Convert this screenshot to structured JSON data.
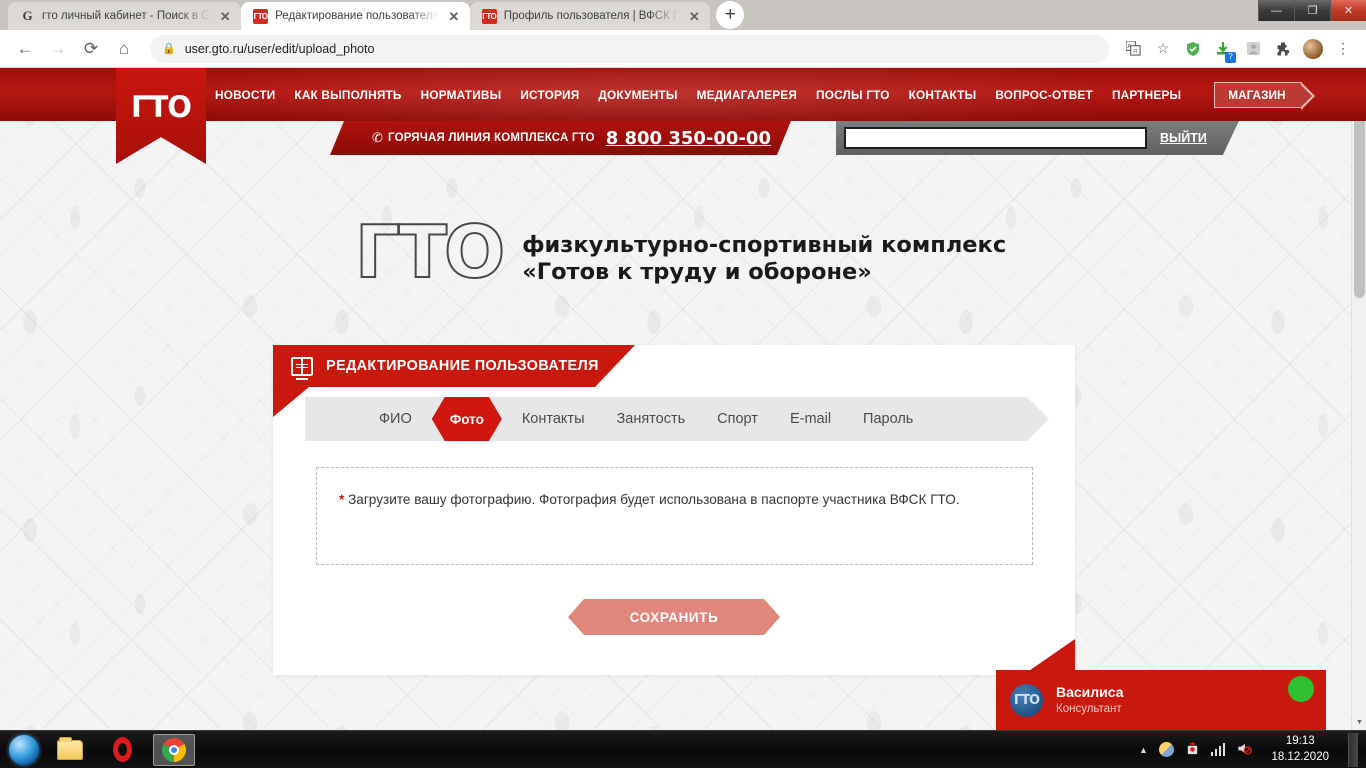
{
  "browser": {
    "tabs": [
      {
        "title": "гто личный кабинет - Поиск в G",
        "favicon": "google-icon",
        "active": false,
        "close_label": "✕"
      },
      {
        "title": "Редактирование пользователя",
        "favicon": "gto-favicon",
        "active": true,
        "close_label": "✕"
      },
      {
        "title": "Профиль пользователя | ВФСК Г",
        "favicon": "gto-favicon",
        "active": false,
        "close_label": "✕"
      }
    ],
    "new_tab_label": "+",
    "window_controls": {
      "minimize": "—",
      "maximize": "❐",
      "close": "✕"
    },
    "nav": {
      "back": "←",
      "forward": "→",
      "reload": "⟳",
      "home": "⌂"
    },
    "omnibox": {
      "lock": "🔒",
      "url": "user.gto.ru/user/edit/upload_photo"
    },
    "toolbar_icons": [
      {
        "name": "translate-icon",
        "glyph": "⇄"
      },
      {
        "name": "bookmark-star-icon",
        "glyph": "☆"
      },
      {
        "name": "adblock-shield-icon",
        "glyph": "🛡"
      },
      {
        "name": "download-icon",
        "glyph": "⬇",
        "badge": "?"
      },
      {
        "name": "extension-grey-icon",
        "glyph": "▣"
      },
      {
        "name": "extensions-puzzle-icon",
        "glyph": "🧩"
      },
      {
        "name": "profile-avatar-icon",
        "glyph": ""
      },
      {
        "name": "chrome-menu-icon",
        "glyph": "⋮"
      }
    ]
  },
  "site": {
    "logo_text": "ГТО",
    "nav_items": [
      "НОВОСТИ",
      "КАК ВЫПОЛНЯТЬ",
      "НОРМАТИВЫ",
      "ИСТОРИЯ",
      "ДОКУМЕНТЫ",
      "МЕДИАГАЛЕРЕЯ",
      "ПОСЛЫ ГТО",
      "КОНТАКТЫ",
      "ВОПРОС-ОТВЕТ",
      "ПАРТНЕРЫ"
    ],
    "shop_label": "МАГАЗИН",
    "hotline": {
      "phone_icon": "✆",
      "label": "ГОРЯЧАЯ ЛИНИЯ КОМПЛЕКСА ГТО",
      "number": "8 800 350-00-00"
    },
    "search": {
      "value": "",
      "placeholder": ""
    },
    "logout_label": "ВЫЙТИ",
    "wordmark": {
      "glyph": "ГТО",
      "line1": "физкультурно-спортивный комплекс",
      "line2": "«Готов к труду и обороне»"
    }
  },
  "card": {
    "header_title": "РЕДАКТИРОВАНИЕ ПОЛЬЗОВАТЕЛЯ",
    "header_icon": "document-monitor-icon",
    "tabs": [
      {
        "label": "ФИО",
        "active": false
      },
      {
        "label": "Фото",
        "active": true
      },
      {
        "label": "Контакты",
        "active": false
      },
      {
        "label": "Занятость",
        "active": false
      },
      {
        "label": "Спорт",
        "active": false
      },
      {
        "label": "E-mail",
        "active": false
      },
      {
        "label": "Пароль",
        "active": false
      }
    ],
    "info": {
      "star": "*",
      "text": " Загрузите вашу фотографию. Фотография будет использована в паспорте участника ВФСК ГТО."
    },
    "save_label": "СОХРАНИТЬ"
  },
  "chat": {
    "avatar_text": "ГТО",
    "name": "Василиса",
    "role": "Консультант"
  },
  "taskbar": {
    "start_label": "",
    "apps": [
      {
        "name": "file-explorer-icon",
        "active": false
      },
      {
        "name": "opera-icon",
        "active": false
      },
      {
        "name": "chrome-icon",
        "active": true
      }
    ],
    "tray": {
      "caret": "▲",
      "items": [
        "weather-icon",
        "antivirus-icon",
        "network-icon",
        "volume-muted-icon"
      ]
    },
    "clock_time": "19:13",
    "clock_date": "18.12.2020"
  },
  "colors": {
    "brand_red": "#c9190f",
    "nav_red": "#b51712",
    "save_salmon": "#e0867c",
    "chat_green": "#2fc02f"
  }
}
